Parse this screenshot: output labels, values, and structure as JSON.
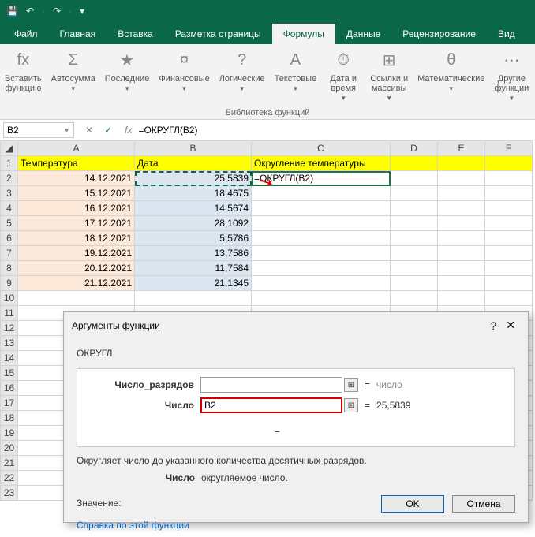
{
  "qat": {
    "save": "💾",
    "undo": "↶",
    "redo": "↷"
  },
  "tabs": {
    "file": "Файл",
    "items": [
      "Главная",
      "Вставка",
      "Разметка страницы",
      "Формулы",
      "Данные",
      "Рецензирование",
      "Вид"
    ],
    "active": "Формулы"
  },
  "ribbon": {
    "group_label": "Библиотека функций",
    "buttons": [
      {
        "icon": "fx",
        "label": "Вставить\nфункцию",
        "drop": false
      },
      {
        "icon": "Σ",
        "label": "Автосумма",
        "drop": true
      },
      {
        "icon": "★",
        "label": "Последние",
        "drop": true
      },
      {
        "icon": "¤",
        "label": "Финансовые",
        "drop": true
      },
      {
        "icon": "?",
        "label": "Логические",
        "drop": true
      },
      {
        "icon": "A",
        "label": "Текстовые",
        "drop": true
      },
      {
        "icon": "⏱",
        "label": "Дата и\nвремя",
        "drop": true
      },
      {
        "icon": "⊞",
        "label": "Ссылки и\nмассивы",
        "drop": true
      },
      {
        "icon": "θ",
        "label": "Математические",
        "drop": true
      },
      {
        "icon": "⋯",
        "label": "Другие\nфункции",
        "drop": true
      }
    ]
  },
  "namebox": "B2",
  "fbar": {
    "cancel": "✕",
    "confirm": "✓",
    "fx": "fx",
    "formula": "=ОКРУГЛ(B2)"
  },
  "sheet": {
    "cols": [
      "A",
      "B",
      "C",
      "D",
      "E",
      "F"
    ],
    "headers": {
      "A": "Температура",
      "B": "Дата",
      "C": "Округление температуры"
    },
    "rows": [
      {
        "n": 2,
        "A": "14.12.2021",
        "B": "25,5839",
        "C": "=ОКРУГЛ(B2)"
      },
      {
        "n": 3,
        "A": "15.12.2021",
        "B": "18,4675",
        "C": ""
      },
      {
        "n": 4,
        "A": "16.12.2021",
        "B": "14,5674",
        "C": ""
      },
      {
        "n": 5,
        "A": "17.12.2021",
        "B": "28,1092",
        "C": ""
      },
      {
        "n": 6,
        "A": "18.12.2021",
        "B": "5,5786",
        "C": ""
      },
      {
        "n": 7,
        "A": "19.12.2021",
        "B": "13,7586",
        "C": ""
      },
      {
        "n": 8,
        "A": "20.12.2021",
        "B": "11,7584",
        "C": ""
      },
      {
        "n": 9,
        "A": "21.12.2021",
        "B": "21,1345",
        "C": ""
      }
    ],
    "blank_rows": [
      10,
      11,
      12,
      13,
      14,
      15,
      16,
      17,
      18,
      19,
      20,
      21,
      22,
      23
    ]
  },
  "dialog": {
    "title": "Аргументы функции",
    "fn": "ОКРУГЛ",
    "args": [
      {
        "label": "Число",
        "value": "B2",
        "result": "25,5839",
        "active": true
      },
      {
        "label": "Число_разрядов",
        "value": "",
        "result": "число",
        "placeholder": true
      }
    ],
    "eq_alone": "=",
    "desc": "Округляет число до указанного количества десятичных разрядов.",
    "arg_name": "Число",
    "arg_desc": "округляемое число.",
    "result_label": "Значение:",
    "help": "Справка по этой функции",
    "ok": "OK",
    "cancel": "Отмена"
  }
}
